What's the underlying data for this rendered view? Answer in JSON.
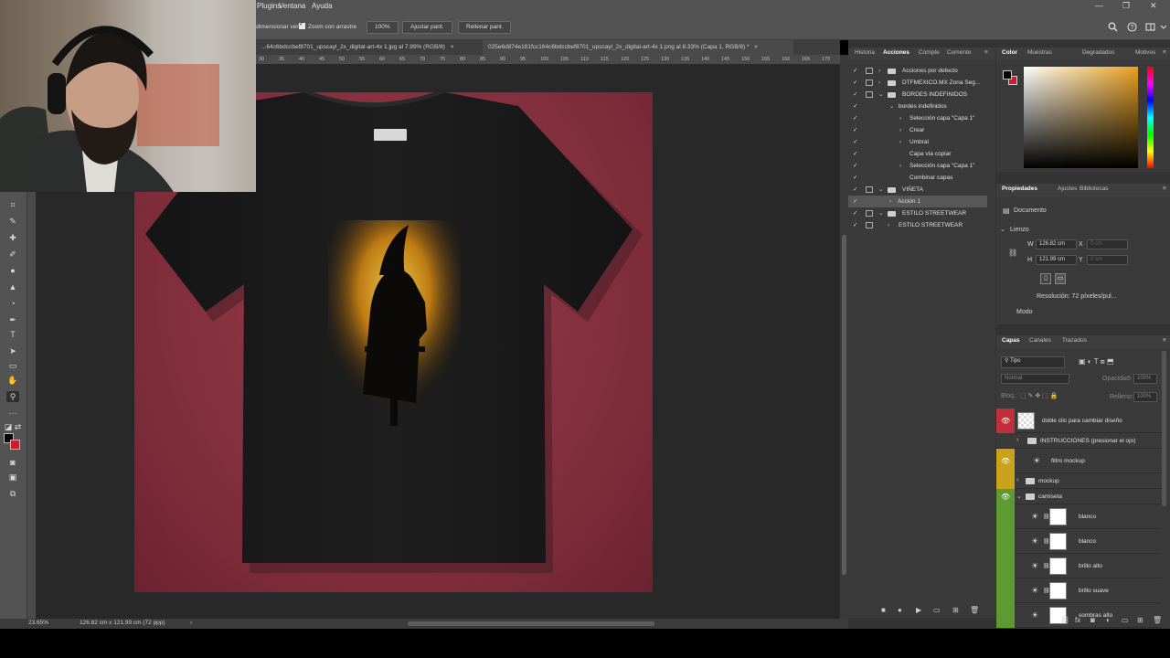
{
  "menu": {
    "items": [
      "Plugins",
      "Ventana",
      "Ayuda"
    ]
  },
  "window_controls": {
    "minimize": "—",
    "restore": "❐",
    "close": "✕"
  },
  "options_bar": {
    "checkbox1_label": "Redimensionar vent.",
    "checkbox2_label": "Zoom con arrastre",
    "zoom_value": "100%",
    "fit_label": "Ajustar pant.",
    "fill_label": "Rellenar pant."
  },
  "document_tabs": [
    {
      "label": "...64c6bdccbef8701_upscayl_2x_digital-art-4x 1.jpg al 7.99% (RGB/8)",
      "close": "×"
    },
    {
      "label": "025e6d874e181fcc164c6bdccbef8701_upscayl_2x_digital-art-4x 1.png al 8.33% (Capa 1, RGB/8) *",
      "close": "×"
    }
  ],
  "ruler_ticks": [
    "30",
    "35",
    "40",
    "45",
    "50",
    "55",
    "60",
    "65",
    "70",
    "75",
    "80",
    "85",
    "90",
    "95",
    "100",
    "105",
    "110",
    "115",
    "120",
    "125",
    "130",
    "135",
    "140",
    "145",
    "150",
    "155",
    "160",
    "165",
    "170"
  ],
  "status": {
    "zoom": "23.65%",
    "doc_size": "126.82 cm x 121.99 cm (72 ppp)",
    "arrow": "›"
  },
  "actions_panel": {
    "tabs": [
      "Historia",
      "Acciones",
      "Compte",
      "Comente"
    ],
    "active_tab": "Acciones",
    "rows": [
      {
        "label": "Acciones por defecto",
        "indent": 0,
        "folder": true,
        "expanded": false
      },
      {
        "label": "DTFMEXICO.MX Zona Seg...",
        "indent": 0,
        "folder": true,
        "expanded": false
      },
      {
        "label": "BORDES INDEFINIDOS",
        "indent": 0,
        "folder": true,
        "expanded": true
      },
      {
        "label": "bordes indefinidos",
        "indent": 1,
        "folder": false,
        "expanded": true
      },
      {
        "label": "Selección capa \"Capa 1\"",
        "indent": 2,
        "folder": false,
        "expanded": false
      },
      {
        "label": "Crear",
        "indent": 2,
        "folder": false,
        "expanded": false
      },
      {
        "label": "Umbral",
        "indent": 2,
        "folder": false,
        "expanded": false
      },
      {
        "label": "Capa vía copiar",
        "indent": 2,
        "folder": false,
        "expanded": null
      },
      {
        "label": "Selección capa \"Capa 1\"",
        "indent": 2,
        "folder": false,
        "expanded": false
      },
      {
        "label": "Combinar capas",
        "indent": 2,
        "folder": false,
        "expanded": null
      },
      {
        "label": "VIÑETA",
        "indent": 0,
        "folder": true,
        "expanded": true
      },
      {
        "label": "Acción 1",
        "indent": 1,
        "folder": false,
        "expanded": false,
        "selected": true
      },
      {
        "label": "ESTILO STREETWEAR",
        "indent": 0,
        "folder": true,
        "expanded": true
      },
      {
        "label": "ESTILO STREETWEAR",
        "indent": 1,
        "folder": false,
        "expanded": false
      }
    ],
    "footer_icons": [
      "stop",
      "record",
      "play",
      "folder",
      "new",
      "delete"
    ]
  },
  "color_panel": {
    "tabs": [
      "Color",
      "Muestras",
      "Degradados",
      "Motivos"
    ],
    "active_tab": "Color",
    "foreground": "#000000",
    "background": "#cc1e2a",
    "hue_color": "#e8a020"
  },
  "properties_panel": {
    "tabs": [
      "Propiedades",
      "Ajustes",
      "Bibliotecas"
    ],
    "active_tab": "Propiedades",
    "doc_label": "Documento",
    "section": "Lienzo",
    "width_label": "W",
    "width_value": "126.82 cm",
    "height_label": "H",
    "height_value": "121.99 cm",
    "x_label": "X",
    "y_label": "Y",
    "x_placeholder": "0 cm",
    "y_placeholder": "0 cm",
    "resolution": "Resolución: 72 píxeles/pul...",
    "mode_label": "Modo"
  },
  "layers_panel": {
    "tabs": [
      "Capas",
      "Canales",
      "Trazados"
    ],
    "active_tab": "Capas",
    "filter_label": "Tipo",
    "blend_mode": "Normal",
    "opacity_label": "Opacidad:",
    "opacity_value": "100%",
    "lock_label": "Bloq.:",
    "fill_label": "Relleno:",
    "fill_value": "100%",
    "layers": [
      {
        "name": "doble clic para cambiar diseño",
        "tag": "#c0303a",
        "visible": true,
        "kind": "smart",
        "indent": 0
      },
      {
        "name": "INSTRUCCIONES (presionar el ojo)",
        "tag": null,
        "visible": false,
        "kind": "group",
        "indent": 0
      },
      {
        "name": "filtro mockup",
        "tag": "#c9a11a",
        "visible": true,
        "kind": "adjustment",
        "indent": 0
      },
      {
        "name": "mockup",
        "tag": "#c9a11a",
        "visible": false,
        "kind": "group",
        "indent": 0
      },
      {
        "name": "camiseta",
        "tag": "#5e9a32",
        "visible": true,
        "kind": "group-open",
        "indent": 0
      },
      {
        "name": "blanco",
        "tag": "#5e9a32",
        "visible": false,
        "kind": "adj-mask",
        "indent": 1
      },
      {
        "name": "blanco",
        "tag": "#5e9a32",
        "visible": false,
        "kind": "adj-mask",
        "indent": 1
      },
      {
        "name": "brillo alto",
        "tag": "#5e9a32",
        "visible": false,
        "kind": "adj-mask",
        "indent": 1
      },
      {
        "name": "brillo suave",
        "tag": "#5e9a32",
        "visible": false,
        "kind": "adj-mask",
        "indent": 1
      },
      {
        "name": "sombras alto",
        "tag": "#5e9a32",
        "visible": false,
        "kind": "adj-mask",
        "indent": 1
      }
    ],
    "footer_icons": [
      "link",
      "fx",
      "mask",
      "adjustment",
      "group",
      "new",
      "delete"
    ]
  }
}
